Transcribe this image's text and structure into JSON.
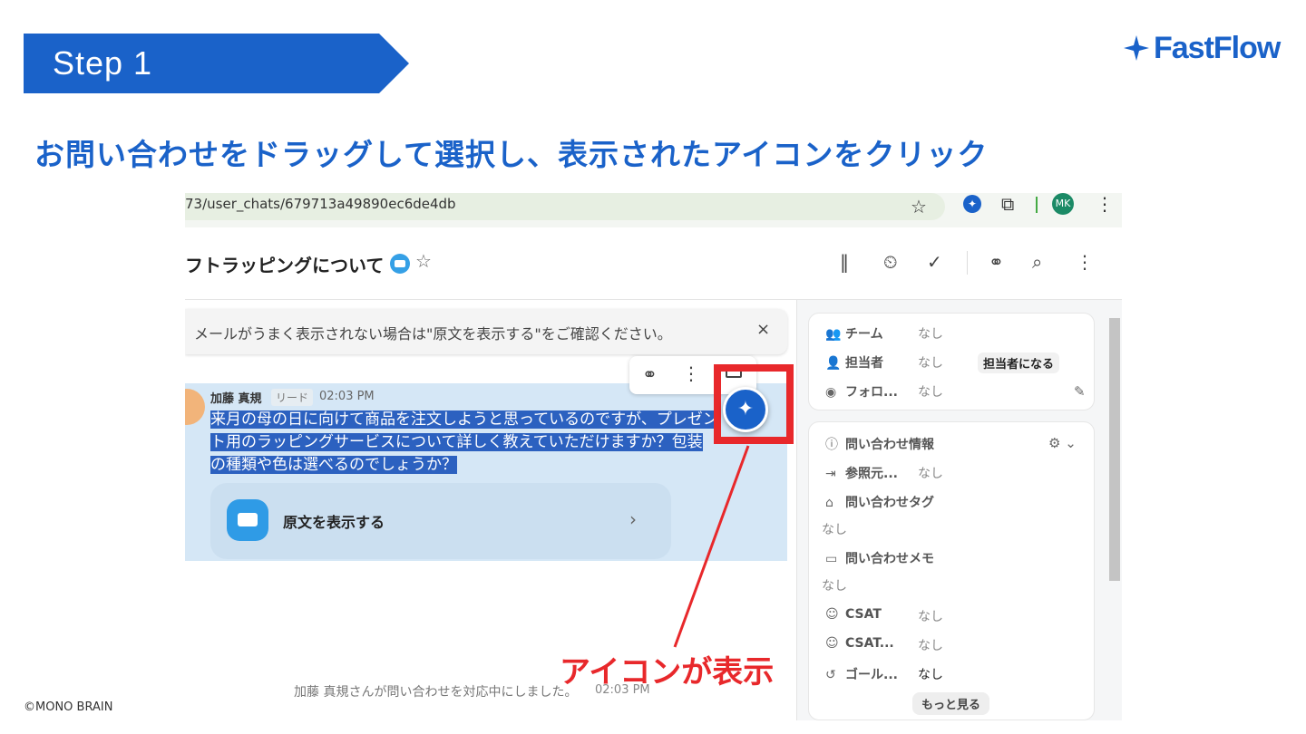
{
  "slide": {
    "step_label": "Step 1",
    "title": "お問い合わせをドラッグして選択し、表示されたアイコンをクリック",
    "callout": "アイコンが表示",
    "copyright": "©MONO BRAIN",
    "logo_text": "FastFlow",
    "accent_color": "#1a62c9",
    "callout_color": "#e8282b"
  },
  "browser": {
    "url": "73/user_chats/679713a49890ec6de4db",
    "avatar_initials": "MK"
  },
  "chat": {
    "title": "フトラッピングについて",
    "notice": "メールがうまく表示されない場合は\"原文を表示する\"をご確認ください。",
    "message": {
      "author": "加藤 真規",
      "tag": "リード",
      "time": "02:03 PM",
      "lines": [
        "来月の母の日に向けて商品を注文しようと思っているのですが、プレゼン",
        "ト用のラッピングサービスについて詳しく教えていただけますか？包装",
        "の種類や色は選べるのでしょうか？"
      ],
      "original_label": "原文を表示する"
    },
    "system_text": "加藤 真規さんが問い合わせを対応中にしました。",
    "system_time": "02:03 PM"
  },
  "sidebar": {
    "assign": {
      "team_label": "チーム",
      "team_value": "なし",
      "assignee_label": "担当者",
      "assignee_value": "なし",
      "become_assignee": "担当者になる",
      "follower_label": "フォロ...",
      "follower_value": "なし"
    },
    "info": {
      "header": "問い合わせ情報",
      "referrer_label": "参照元...",
      "referrer_value": "なし",
      "tag_label": "問い合わせタグ",
      "tag_value": "なし",
      "memo_label": "問い合わせメモ",
      "memo_value": "なし",
      "csat_label": "CSAT",
      "csat_value": "なし",
      "csat2_label": "CSAT...",
      "csat2_value": "なし",
      "goal_label": "ゴール...",
      "goal_value": "なし",
      "more_label": "もっと見る"
    }
  }
}
